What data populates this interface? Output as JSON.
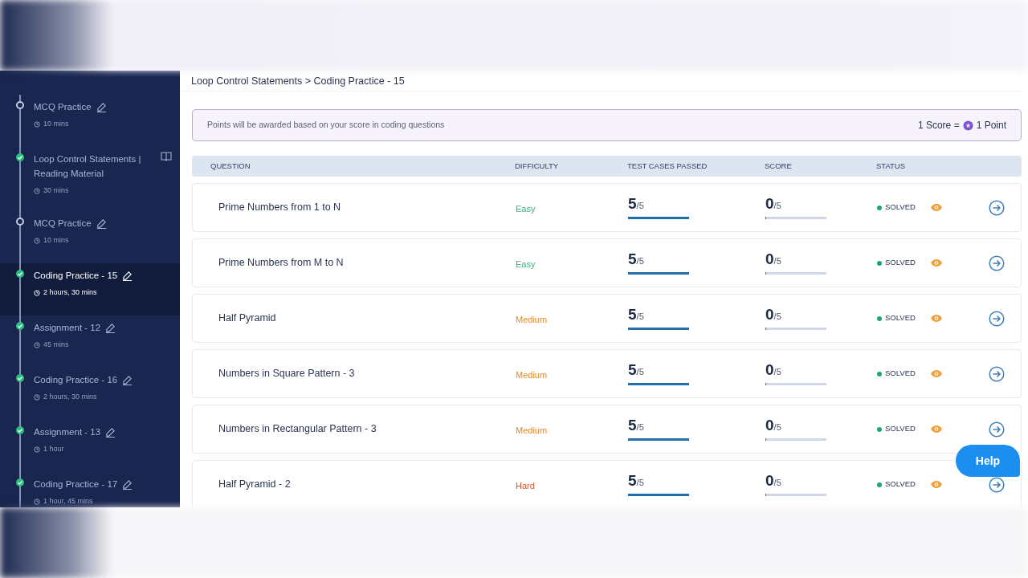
{
  "sidebar": {
    "items": [
      {
        "title": "MCQ Practice",
        "duration": "10 mins",
        "completed": false,
        "kind": "edit",
        "selected": false
      },
      {
        "title": "Loop Control Statements | Reading Material",
        "duration": "30 mins",
        "completed": true,
        "kind": "reading",
        "selected": false
      },
      {
        "title": "MCQ Practice",
        "duration": "10 mins",
        "completed": false,
        "kind": "edit",
        "selected": false
      },
      {
        "title": "Coding Practice - 15",
        "duration": "2 hours, 30 mins",
        "completed": true,
        "kind": "edit",
        "selected": true
      },
      {
        "title": "Assignment - 12",
        "duration": "45 mins",
        "completed": true,
        "kind": "edit",
        "selected": false
      },
      {
        "title": "Coding Practice - 16",
        "duration": "2 hours, 30 mins",
        "completed": true,
        "kind": "edit",
        "selected": false
      },
      {
        "title": "Assignment - 13",
        "duration": "1 hour",
        "completed": true,
        "kind": "edit",
        "selected": false
      },
      {
        "title": "Coding Practice - 17",
        "duration": "1 hour, 45 mins",
        "completed": true,
        "kind": "edit",
        "selected": false
      }
    ]
  },
  "breadcrumb": "Loop Control Statements > Coding Practice - 15",
  "notice": {
    "text": "Points will be awarded based on your score in coding questions",
    "score_label": "1 Score =",
    "point_label": "1 Point"
  },
  "table": {
    "columns": [
      "QUESTION",
      "DIFFICULTY",
      "TEST CASES PASSED",
      "SCORE",
      "STATUS"
    ],
    "rows": [
      {
        "question": "Prime Numbers from 1 to N",
        "difficulty": {
          "label": "Easy",
          "color": "#3fae7a"
        },
        "passed": {
          "value": "5",
          "total": "/5",
          "level": 1
        },
        "score": {
          "value": "0",
          "total": "/5",
          "level": 0
        },
        "status": "SOLVED"
      },
      {
        "question": "Prime Numbers from M to N",
        "difficulty": {
          "label": "Easy",
          "color": "#3fae7a"
        },
        "passed": {
          "value": "5",
          "total": "/5",
          "level": 1
        },
        "score": {
          "value": "0",
          "total": "/5",
          "level": 0
        },
        "status": "SOLVED"
      },
      {
        "question": "Half Pyramid",
        "difficulty": {
          "label": "Medium",
          "color": "#e08a2c"
        },
        "passed": {
          "value": "5",
          "total": "/5",
          "level": 1
        },
        "score": {
          "value": "0",
          "total": "/5",
          "level": 0
        },
        "status": "SOLVED"
      },
      {
        "question": "Numbers in Square Pattern - 3",
        "difficulty": {
          "label": "Medium",
          "color": "#e08a2c"
        },
        "passed": {
          "value": "5",
          "total": "/5",
          "level": 1
        },
        "score": {
          "value": "0",
          "total": "/5",
          "level": 0
        },
        "status": "SOLVED"
      },
      {
        "question": "Numbers in Rectangular Pattern - 3",
        "difficulty": {
          "label": "Medium",
          "color": "#e08a2c"
        },
        "passed": {
          "value": "5",
          "total": "/5",
          "level": 1
        },
        "score": {
          "value": "0",
          "total": "/5",
          "level": 0
        },
        "status": "SOLVED"
      },
      {
        "question": "Half Pyramid - 2",
        "difficulty": {
          "label": "Hard",
          "color": "#d9542b"
        },
        "passed": {
          "value": "5",
          "total": "/5",
          "level": 1
        },
        "score": {
          "value": "0",
          "total": "/5",
          "level": 0
        },
        "status": "SOLVED"
      }
    ]
  },
  "help_button": "Help"
}
